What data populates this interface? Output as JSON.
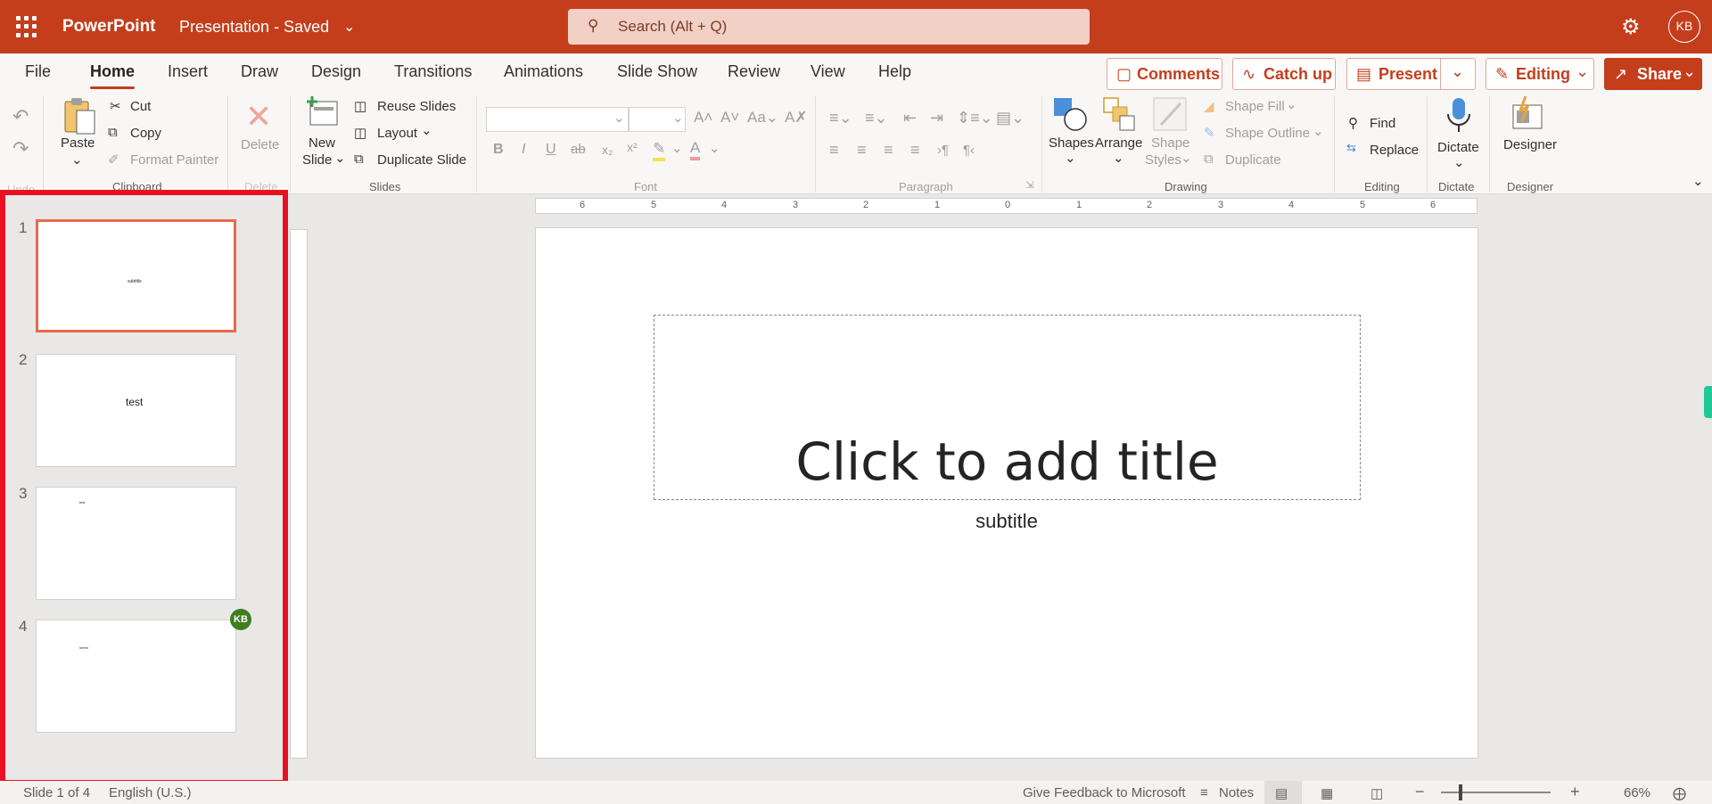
{
  "titlebar": {
    "app_name": "PowerPoint",
    "doc_name": "Presentation  -  Saved",
    "search_placeholder": "Search (Alt + Q)",
    "user_initials": "KB"
  },
  "tabs": [
    "File",
    "Home",
    "Insert",
    "Draw",
    "Design",
    "Transitions",
    "Animations",
    "Slide Show",
    "Review",
    "View",
    "Help"
  ],
  "active_tab": "Home",
  "top_buttons": {
    "comments": "Comments",
    "catch_up": "Catch up",
    "present": "Present",
    "editing": "Editing",
    "share": "Share"
  },
  "ribbon": {
    "undo_group": "Undo",
    "paste": "Paste",
    "cut": "Cut",
    "copy": "Copy",
    "format_painter": "Format Painter",
    "clipboard_group": "Clipboard",
    "delete": "Delete",
    "delete_group": "Delete",
    "new_slide_1": "New",
    "new_slide_2": "Slide",
    "reuse_slides": "Reuse Slides",
    "layout": "Layout",
    "duplicate_slide": "Duplicate Slide",
    "slides_group": "Slides",
    "font_group": "Font",
    "paragraph_group": "Paragraph",
    "shapes": "Shapes",
    "arrange": "Arrange",
    "shape_styles_1": "Shape",
    "shape_styles_2": "Styles",
    "shape_fill": "Shape Fill",
    "shape_outline": "Shape Outline",
    "duplicate": "Duplicate",
    "drawing_group": "Drawing",
    "find": "Find",
    "replace": "Replace",
    "editing_group": "Editing",
    "dictate": "Dictate",
    "dictate_group": "Dictate",
    "designer": "Designer",
    "designer_group": "Designer"
  },
  "thumbnails": [
    {
      "number": "1",
      "text": "subtitle"
    },
    {
      "number": "2",
      "text": "test"
    },
    {
      "number": "3",
      "text": "test"
    },
    {
      "number": "4",
      "text": "lorem",
      "avatar": "KB"
    }
  ],
  "ruler_labels": [
    "6",
    "5",
    "4",
    "3",
    "2",
    "1",
    "0",
    "1",
    "2",
    "3",
    "4",
    "5",
    "6"
  ],
  "slide": {
    "title_placeholder": "Click to add title",
    "subtitle": "subtitle"
  },
  "statusbar": {
    "slide_info": "Slide 1 of 4",
    "language": "English (U.S.)",
    "feedback": "Give Feedback to Microsoft",
    "notes": "Notes",
    "zoom": "66%"
  },
  "colors": {
    "brand": "#c43e1c",
    "selection_outline": "#e81123"
  }
}
